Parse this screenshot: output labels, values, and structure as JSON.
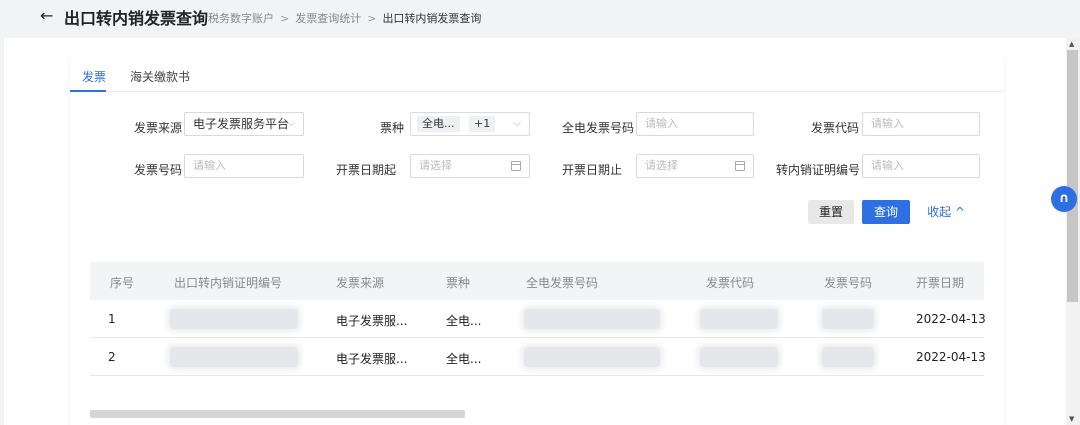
{
  "header": {
    "back_icon": "←",
    "title": "出口转内销发票查询",
    "breadcrumb": [
      "税务数字账户",
      "发票查询统计",
      "出口转内销发票查询"
    ],
    "separator": ">"
  },
  "tabs": [
    {
      "label": "发票",
      "active": true
    },
    {
      "label": "海关缴款书",
      "active": false
    }
  ],
  "filters": {
    "invoice_source": {
      "label": "发票来源",
      "value": "电子发票服务平台"
    },
    "ticket_type": {
      "label": "票种",
      "tag": "全电...",
      "count": "+1"
    },
    "full_invoice_no": {
      "label": "全电发票号码",
      "placeholder": "请输入"
    },
    "invoice_code": {
      "label": "发票代码",
      "placeholder": "请输入"
    },
    "invoice_no": {
      "label": "发票号码",
      "placeholder": "请输入"
    },
    "date_start": {
      "label": "开票日期起",
      "placeholder": "请选择"
    },
    "date_end": {
      "label": "开票日期止",
      "placeholder": "请选择"
    },
    "cert_no": {
      "label": "转内销证明编号",
      "placeholder": "请输入"
    }
  },
  "actions": {
    "reset": "重置",
    "query": "查询",
    "collapse": "收起 ^"
  },
  "table": {
    "columns": [
      "序号",
      "出口转内销证明编号",
      "发票来源",
      "票种",
      "全电发票号码",
      "发票代码",
      "发票号码",
      "开票日期"
    ],
    "rows": [
      {
        "index": "1",
        "source": "电子发票服...",
        "type": "全电...",
        "date": "2022-04-13"
      },
      {
        "index": "2",
        "source": "电子发票服...",
        "type": "全电...",
        "date": "2022-04-13"
      }
    ]
  },
  "float_button_icon": "headset-icon",
  "colors": {
    "accent": "#2f6fe4"
  }
}
